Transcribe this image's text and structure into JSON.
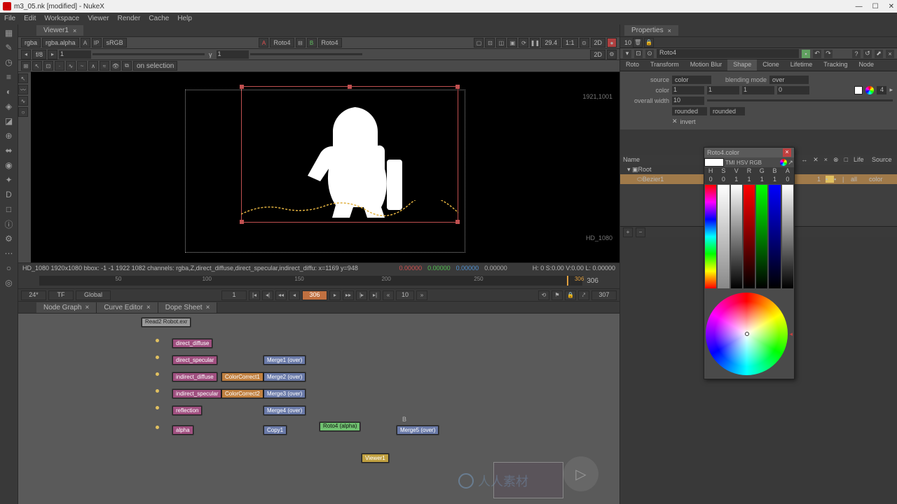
{
  "title": "m3_05.nk [modified] - NukeX",
  "menus": [
    "File",
    "Edit",
    "Workspace",
    "Viewer",
    "Render",
    "Cache",
    "Help"
  ],
  "viewer": {
    "tab": "Viewer1",
    "channel": "rgba",
    "layer": "rgba.alpha",
    "gamma_btn": "A",
    "ip": "IP",
    "colorspace": "sRGB",
    "slotA": "A",
    "slotA_node": "Roto4",
    "slotB": "B",
    "slotB_node": "Roto4",
    "zoom": "29.4",
    "ratio": "1:1",
    "proj": "2D",
    "f_stop": "f/8",
    "exposure": "1",
    "gamma_val": "1",
    "tool_mode": "on selection",
    "bbox_coords": "1921,1001",
    "format_label": "HD_1080"
  },
  "status": {
    "left": "HD_1080 1920x1080  bbox: -1 -1 1922 1082 channels: rgba,Z,direct_diffuse,direct_specular,indirect_diffu: x=1169 y=948",
    "r": "0.00000",
    "g": "0.00000",
    "b": "0.00000",
    "a": "0.00000",
    "hsv": "H: 0 S:0.00 V:0.00  L: 0.00000"
  },
  "timeline": {
    "ticks": [
      "50",
      "100",
      "150",
      "200",
      "250"
    ],
    "cursor": "306",
    "end": "306"
  },
  "playback": {
    "fps": "24*",
    "mode": "TF",
    "scope": "Global",
    "start": "1",
    "current": "306",
    "step": "10",
    "end": "307"
  },
  "lower_tabs": [
    "Node Graph",
    "Curve Editor",
    "Dope Sheet"
  ],
  "nodes": {
    "read": "Read2\nRobot.exr",
    "row1": "direct_diffuse",
    "row2": "direct_specular",
    "row2m": "Merge1 (over)",
    "row3": "indirect_diffuse",
    "row3c": "ColorCorrect1",
    "row3m": "Merge2 (over)",
    "row4": "indirect_specular",
    "row4c": "ColorCorrect2",
    "row4m": "Merge3 (over)",
    "row5": "reflection",
    "row5m": "Merge4 (over)",
    "row6": "alpha",
    "row6c": "Copy1",
    "roto": "Roto4\n(alpha)",
    "row6m": "Merge5 (over)",
    "viewer": "Viewer1",
    "dot": "B"
  },
  "props": {
    "panel": "Properties",
    "max": "10",
    "node_name": "Roto4",
    "tabs": [
      "Roto",
      "Transform",
      "Motion Blur",
      "Shape",
      "Clone",
      "Lifetime",
      "Tracking",
      "Node"
    ],
    "active_tab": "Shape",
    "source": "source",
    "source_val": "color",
    "blend_lbl": "blending mode",
    "blend_val": "over",
    "color_lbl": "color",
    "c_r": "1",
    "c_g": "1",
    "c_b": "1",
    "c_a": "0",
    "width_lbl": "overall width",
    "width_val": "10",
    "cap1": "rounded",
    "cap2": "rounded",
    "invert": "invert",
    "col_name": "Name",
    "cols": [
      "#",
      "⊙",
      "✓",
      "↔",
      "✕",
      "×",
      "⊗",
      "□",
      "Life",
      "Source"
    ],
    "root": "Root",
    "bezier": "Bezier1",
    "bez_vals": [
      "1",
      "all",
      "color"
    ],
    "add": "+",
    "del": "−"
  },
  "color_popup": {
    "title": "Roto4.color",
    "tabs": "TMI HSV RGB",
    "ch_hdr": [
      "H",
      "S",
      "V",
      "R",
      "G",
      "B",
      "A"
    ],
    "ch_val": [
      "0",
      "0",
      "1",
      "1",
      "1",
      "1",
      "0"
    ]
  },
  "wm": "人人素材"
}
